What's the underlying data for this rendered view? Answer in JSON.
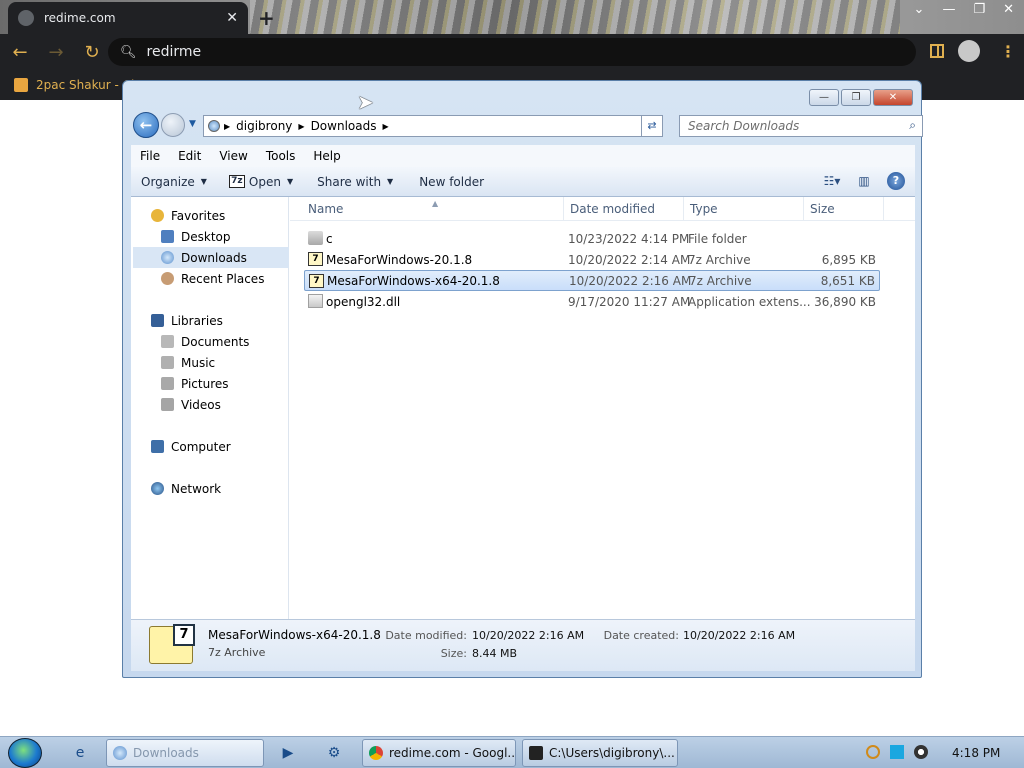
{
  "browser": {
    "tab_title": "redime.com",
    "new_tab_symbol": "+",
    "omnibox_text": "redirme",
    "bookmark_label": "2pac Shakur - Cl",
    "window_controls": [
      "⌄",
      "—",
      "❐",
      "✕"
    ]
  },
  "explorer": {
    "window_controls": [
      "—",
      "❐",
      "✕"
    ],
    "breadcrumb": [
      "digibrony",
      "Downloads"
    ],
    "search_placeholder": "Search Downloads",
    "menu": [
      "File",
      "Edit",
      "View",
      "Tools",
      "Help"
    ],
    "commands": {
      "organize": "Organize",
      "open": "Open",
      "share_with": "Share with",
      "new_folder": "New folder"
    },
    "nav": {
      "favorites": "Favorites",
      "desktop": "Desktop",
      "downloads": "Downloads",
      "recent_places": "Recent Places",
      "libraries": "Libraries",
      "documents": "Documents",
      "music": "Music",
      "pictures": "Pictures",
      "videos": "Videos",
      "computer": "Computer",
      "network": "Network"
    },
    "columns": {
      "name": "Name",
      "date_modified": "Date modified",
      "type": "Type",
      "size": "Size"
    },
    "files": [
      {
        "name": "c",
        "date": "10/23/2022 4:14 PM",
        "type": "File folder",
        "size": ""
      },
      {
        "name": "MesaForWindows-20.1.8",
        "date": "10/20/2022 2:14 AM",
        "type": "7z Archive",
        "size": "6,895 KB"
      },
      {
        "name": "MesaForWindows-x64-20.1.8",
        "date": "10/20/2022 2:16 AM",
        "type": "7z Archive",
        "size": "8,651 KB"
      },
      {
        "name": "opengl32.dll",
        "date": "9/17/2020 11:27 AM",
        "type": "Application extens...",
        "size": "36,890 KB"
      }
    ],
    "details": {
      "name": "MesaForWindows-x64-20.1.8",
      "type": "7z Archive",
      "date_modified_label": "Date modified:",
      "date_modified": "10/20/2022 2:16 AM",
      "date_created_label": "Date created:",
      "date_created": "10/20/2022 2:16 AM",
      "size_label": "Size:",
      "size": "8.44 MB",
      "icon_badge": "7"
    }
  },
  "taskbar": {
    "apps": [
      {
        "label": "Downloads"
      },
      {
        "label": "redime.com - Googl..."
      },
      {
        "label": "C:\\Users\\digibrony\\..."
      }
    ],
    "clock": "4:18 PM"
  }
}
